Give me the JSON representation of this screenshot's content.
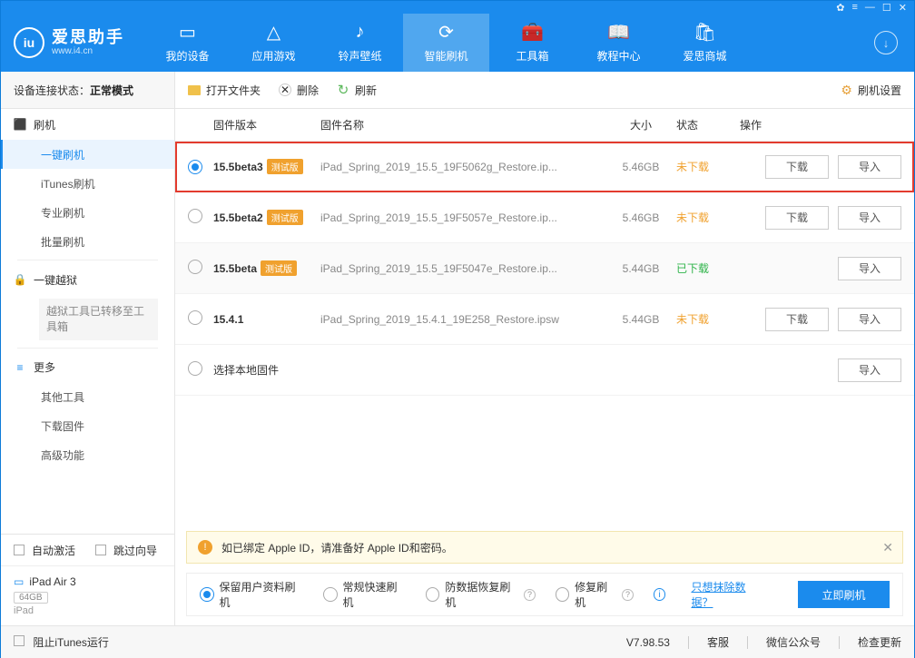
{
  "brand": {
    "name": "爱思助手",
    "sub": "www.i4.cn"
  },
  "nav": {
    "items": [
      {
        "label": "我的设备"
      },
      {
        "label": "应用游戏"
      },
      {
        "label": "铃声壁纸"
      },
      {
        "label": "智能刷机"
      },
      {
        "label": "工具箱"
      },
      {
        "label": "教程中心"
      },
      {
        "label": "爱思商城"
      }
    ]
  },
  "sidebar": {
    "status_prefix": "设备连接状态：",
    "status_value": "正常模式",
    "sections": [
      {
        "head": "刷机",
        "items": [
          "一键刷机",
          "iTunes刷机",
          "专业刷机",
          "批量刷机"
        ]
      },
      {
        "head": "一键越狱",
        "note": "越狱工具已转移至工具箱"
      },
      {
        "head": "更多",
        "items": [
          "其他工具",
          "下载固件",
          "高级功能"
        ]
      }
    ],
    "auto_activate": "自动激活",
    "skip_guide": "跳过向导",
    "device": {
      "name": "iPad Air 3",
      "storage": "64GB",
      "type": "iPad"
    }
  },
  "toolbar": {
    "open": "打开文件夹",
    "delete": "删除",
    "refresh": "刷新",
    "settings": "刷机设置"
  },
  "columns": {
    "version": "固件版本",
    "name": "固件名称",
    "size": "大小",
    "status": "状态",
    "ops": "操作"
  },
  "status_labels": {
    "not_downloaded": "未下载",
    "downloaded": "已下载"
  },
  "buttons": {
    "download": "下载",
    "import": "导入"
  },
  "rows": [
    {
      "selected": true,
      "version": "15.5beta3",
      "beta": true,
      "badge": "测试版",
      "name": "iPad_Spring_2019_15.5_19F5062g_Restore.ip...",
      "size": "5.46GB",
      "status": "not_downloaded",
      "show_dl": true,
      "highlight": true
    },
    {
      "selected": false,
      "version": "15.5beta2",
      "beta": true,
      "badge": "测试版",
      "name": "iPad_Spring_2019_15.5_19F5057e_Restore.ip...",
      "size": "5.46GB",
      "status": "not_downloaded",
      "show_dl": true
    },
    {
      "selected": false,
      "version": "15.5beta",
      "beta": true,
      "badge": "测试版",
      "name": "iPad_Spring_2019_15.5_19F5047e_Restore.ip...",
      "size": "5.44GB",
      "status": "downloaded",
      "show_dl": false,
      "alt": true
    },
    {
      "selected": false,
      "version": "15.4.1",
      "beta": false,
      "name": "iPad_Spring_2019_15.4.1_19E258_Restore.ipsw",
      "size": "5.44GB",
      "status": "not_downloaded",
      "show_dl": true
    },
    {
      "selected": false,
      "local": true,
      "local_label": "选择本地固件"
    }
  ],
  "notice": "如已绑定 Apple ID，请准备好 Apple ID和密码。",
  "flash": {
    "options": [
      "保留用户资料刷机",
      "常规快速刷机",
      "防数据恢复刷机",
      "修复刷机"
    ],
    "selected": 0,
    "link": "只想抹除数据？",
    "action": "立即刷机"
  },
  "footer": {
    "block_itunes": "阻止iTunes运行",
    "version": "V7.98.53",
    "links": [
      "客服",
      "微信公众号",
      "检查更新"
    ]
  }
}
